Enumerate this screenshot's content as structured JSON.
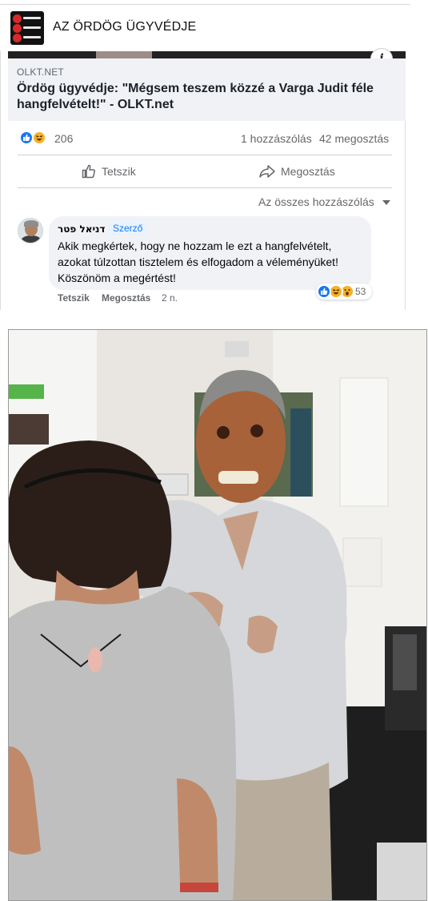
{
  "header": {
    "title": "AZ ÖRDÖG ÜGYVÉDJE"
  },
  "link_preview": {
    "domain": "OLKT.NET",
    "title": "Ördög ügyvédje: \"Mégsem teszem közzé a Varga Judit féle hangfelvételt!\" - OLKT.net"
  },
  "stats": {
    "reactions": "206",
    "comments": "1 hozzászólás",
    "shares": "42 megosztás"
  },
  "actions": {
    "like": "Tetszik",
    "share": "Megosztás"
  },
  "comments_filter": "Az összes hozzászólás",
  "comment": {
    "author": "דניאל פטר",
    "badge": "Szerző",
    "text": "Akik megkértek, hogy ne hozzam le ezt a hangfelvételt, azokat túlzottan tisztelem és elfogadom a véleményüket! Köszönöm a megértést!",
    "reaction_count": "53",
    "like": "Tetszik",
    "share": "Megosztás",
    "time": "2 n."
  },
  "colors": {
    "facebook_blue": "#1877f2",
    "reaction_yellow": "#f7b125",
    "muted_text": "#65676b"
  }
}
